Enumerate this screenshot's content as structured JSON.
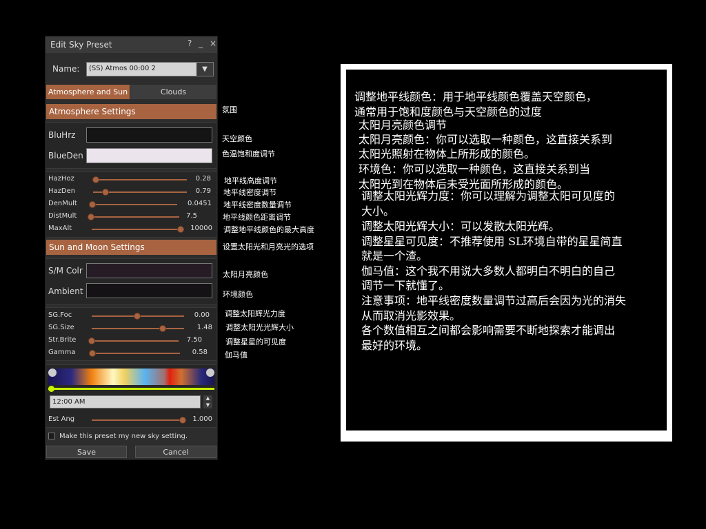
{
  "window": {
    "title": "Edit Sky Preset",
    "help": "?",
    "minimize": "_",
    "close": "×"
  },
  "name_row": {
    "label": "Name:",
    "value": "(SS) Atmos 00:00 2"
  },
  "tabs": [
    {
      "label": "Atmosphere and Sun"
    },
    {
      "label": "Clouds"
    }
  ],
  "atmosphere": {
    "header": "Atmosphere Settings",
    "blu_hrz_label": "BluHrz",
    "blu_hrz_color": "#141414",
    "blue_den_label": "BlueDen",
    "blue_den_color": "#ece4ec",
    "sliders": [
      {
        "label": "HazHoz",
        "value": "0.28"
      },
      {
        "label": "HazDen",
        "value": "0.79"
      },
      {
        "label": "DenMult",
        "value": "0.0451"
      },
      {
        "label": "DistMult",
        "value": "7.5"
      },
      {
        "label": "MaxAlt",
        "value": "10000"
      }
    ]
  },
  "sun_moon": {
    "header": "Sun and Moon Settings",
    "sm_colr_label": "S/M Colr",
    "sm_colr_color": "#261c26",
    "ambient_label": "Ambient",
    "ambient_color": "#141214",
    "sliders": [
      {
        "label": "SG.Foc",
        "value": "0.00"
      },
      {
        "label": "SG.Size",
        "value": "1.48"
      },
      {
        "label": "Str.Brite",
        "value": "7.50"
      },
      {
        "label": "Gamma",
        "value": "0.58"
      }
    ],
    "time_value": "12:00 AM",
    "est_ang_label": "Est Ang",
    "est_ang_value": "1.000"
  },
  "checkbox_label": "Make this preset my new sky setting.",
  "buttons": {
    "save": "Save",
    "cancel": "Cancel"
  },
  "annotations": [
    "氛围",
    "天空颜色",
    "色温饱和度调节",
    "地平线高度调节",
    "地平线密度调节",
    "地平线密度数量调节",
    "地平线颜色距离调节",
    "调整地平线颜色的最大高度",
    "设置太阳光和月亮光的选项",
    "太阳月亮颜色",
    "环境颜色",
    "调整太阳辉光力度",
    "调整太阳光光辉大小",
    "调整星星的可见度",
    "伽马值"
  ],
  "notes": [
    "调整地平线颜色：用于地平线颜色覆盖天空颜色，",
    "通常用于饱和度颜色与天空颜色的过度",
    "太阳月亮颜色调节",
    "太阳月亮颜色：你可以选取一种颜色，这直接关系到",
    "太阳光照射在物体上所形成的颜色。",
    "环境色：你可以选取一种颜色，这直接关系到当",
    "太阳光到在物体后未受光面所形成的颜色。",
    "调整太阳光辉力度：你可以理解为调整太阳可见度的",
    "大小。",
    "调整太阳光辉大小：可以发散太阳光辉。",
    "调整星星可见度：不推荐使用 SL环境自带的星星简直",
    "就是一个渣。",
    "伽马值：这个我不用说大多数人都明白不明白的自己",
    "调节一下就懂了。",
    "注意事项：地平线密度数量调节过高后会因为光的消失",
    "从而取消光影效果。",
    "各个数值相互之间都会影响需要不断地探索才能调出",
    "最好的环境。"
  ]
}
